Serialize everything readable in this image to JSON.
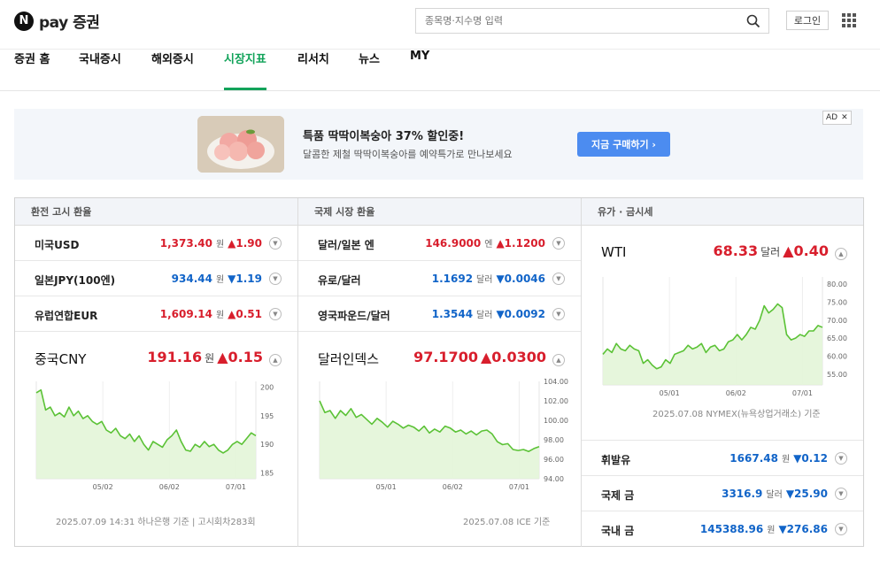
{
  "header": {
    "logo_letter": "N",
    "logo_text": "pay 증권",
    "search_placeholder": "종목명·지수명 입력",
    "login_label": "로그인"
  },
  "nav": {
    "items": [
      {
        "label": "증권 홈"
      },
      {
        "label": "국내증시"
      },
      {
        "label": "해외증시"
      },
      {
        "label": "시장지표",
        "active": true
      },
      {
        "label": "리서치"
      },
      {
        "label": "뉴스"
      },
      {
        "label": "MY"
      }
    ]
  },
  "ad": {
    "title": "특품 딱딱이복숭아 37% 할인중!",
    "desc": "달콤한 제철 딱딱이복숭아를 예약특가로 만나보세요",
    "button": "지금 구매하기 ›",
    "badge": "AD",
    "close": "✕"
  },
  "exchange": {
    "head": "환전 고시 환율",
    "rows": [
      {
        "name": "미국USD",
        "value": "1,373.40",
        "unit": "원",
        "change": "▲1.90",
        "dir": "up"
      },
      {
        "name": "일본JPY(100엔)",
        "value": "934.44",
        "unit": "원",
        "change": "▼1.19",
        "dir": "down"
      },
      {
        "name": "유럽연합EUR",
        "value": "1,609.14",
        "unit": "원",
        "change": "▲0.51",
        "dir": "up"
      }
    ],
    "feature": {
      "name": "중국CNY",
      "value": "191.16",
      "unit": "원",
      "change": "▲0.15",
      "dir": "up"
    },
    "note": "2025.07.09 14:31 하나은행 기준 | 고시회차283회"
  },
  "intl": {
    "head": "국제 시장 환율",
    "rows": [
      {
        "name": "달러/일본 엔",
        "value": "146.9000",
        "unit": "엔",
        "change": "▲1.1200",
        "dir": "up"
      },
      {
        "name": "유로/달러",
        "value": "1.1692",
        "unit": "달러",
        "change": "▼0.0046",
        "dir": "down"
      },
      {
        "name": "영국파운드/달러",
        "value": "1.3544",
        "unit": "달러",
        "change": "▼0.0092",
        "dir": "down"
      }
    ],
    "feature": {
      "name": "달러인덱스",
      "value": "97.1700",
      "unit": "",
      "change": "▲0.0300",
      "dir": "up"
    },
    "note": "2025.07.08 ICE 기준"
  },
  "oil": {
    "head": "유가 · 금시세",
    "feature": {
      "name": "WTI",
      "value": "68.33",
      "unit": "달러",
      "change": "▲0.40",
      "dir": "up"
    },
    "note": "2025.07.08 NYMEX(뉴욕상업거래소) 기준",
    "rows": [
      {
        "name": "휘발유",
        "value": "1667.48",
        "unit": "원",
        "change": "▼0.12",
        "dir": "down"
      },
      {
        "name": "국제 금",
        "value": "3316.9",
        "unit": "달러",
        "change": "▼25.90",
        "dir": "down"
      },
      {
        "name": "국내 금",
        "value": "145388.96",
        "unit": "원",
        "change": "▼276.86",
        "dir": "down"
      }
    ]
  },
  "colors": {
    "up": "#d81e2c",
    "down": "#1164c8",
    "accent": "#12a35a",
    "line": "#5bc236",
    "fill": "#e3f5d8"
  },
  "chart_data": [
    {
      "type": "area",
      "title": "중국CNY",
      "x_ticks": [
        "05/02",
        "06/02",
        "07/01"
      ],
      "ylim": [
        184,
        201
      ],
      "y_ticks": [
        185,
        190,
        195,
        200
      ],
      "values": [
        199,
        199.5,
        196,
        196.5,
        195,
        195.5,
        194.8,
        196.5,
        195,
        195.8,
        194.5,
        195,
        194,
        193.5,
        194,
        192.5,
        192,
        192.8,
        191.5,
        191,
        191.8,
        190.5,
        191.5,
        190,
        189,
        190.5,
        190,
        189.5,
        190.8,
        191.5,
        192.5,
        190.5,
        189,
        188.8,
        190,
        189.5,
        190.5,
        189.6,
        190,
        189,
        188.5,
        189,
        190,
        190.5,
        190,
        191,
        192,
        191.5
      ]
    },
    {
      "type": "area",
      "title": "달러인덱스",
      "x_ticks": [
        "05/01",
        "06/02",
        "07/01"
      ],
      "ylim": [
        94,
        104
      ],
      "y_ticks": [
        94,
        96,
        98,
        100,
        102,
        104
      ],
      "values": [
        102,
        100.8,
        101,
        100.2,
        101,
        100.5,
        101.2,
        100.3,
        100.6,
        100.1,
        99.6,
        100.2,
        99.8,
        99.3,
        99.9,
        99.6,
        99.2,
        99.5,
        99.3,
        98.9,
        99.4,
        98.7,
        99.1,
        98.8,
        99.4,
        99.2,
        98.8,
        99.0,
        98.6,
        98.9,
        98.5,
        98.9,
        99.0,
        98.6,
        97.8,
        97.5,
        97.6,
        97.0,
        96.9,
        97.0,
        96.8,
        97.1,
        97.3
      ]
    },
    {
      "type": "area",
      "title": "WTI",
      "x_ticks": [
        "05/01",
        "06/02",
        "07/01"
      ],
      "ylim": [
        52,
        82
      ],
      "y_ticks": [
        55,
        60,
        65,
        70,
        75,
        80
      ],
      "values": [
        60.5,
        62,
        61,
        63.5,
        62,
        61.5,
        63,
        62,
        61.5,
        58,
        59,
        57.5,
        56.5,
        57,
        59,
        58,
        60.5,
        61,
        61.5,
        63,
        62,
        62.5,
        63.5,
        61,
        62.5,
        63,
        61.5,
        62,
        64,
        64.5,
        66,
        64.5,
        66,
        68,
        67.5,
        70,
        74,
        72,
        73,
        74.5,
        73.5,
        66,
        64.5,
        65,
        66,
        65.5,
        67,
        67,
        68.5,
        68
      ]
    }
  ]
}
